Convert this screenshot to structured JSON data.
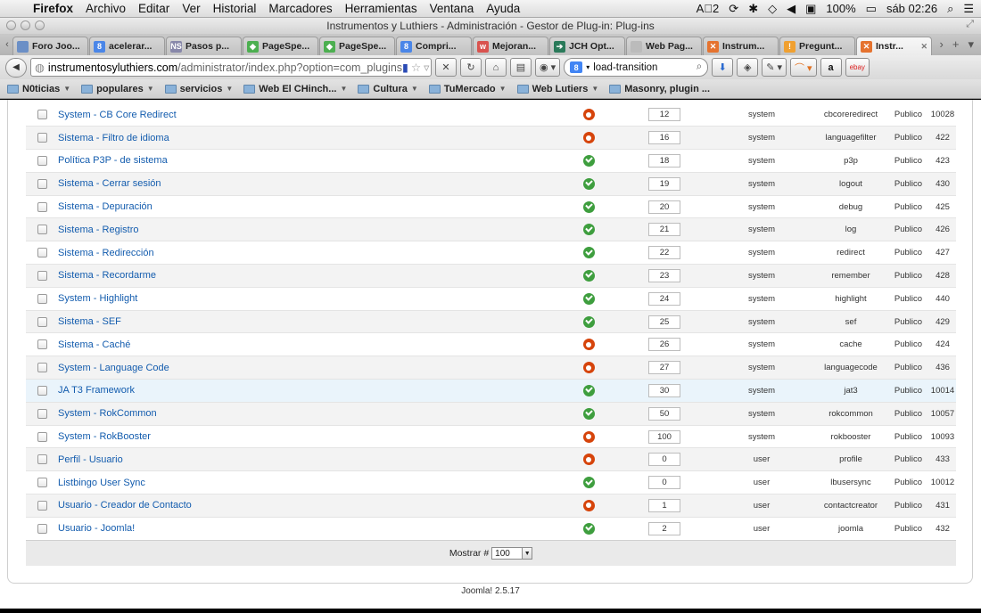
{
  "menubar": {
    "app": "Firefox",
    "items": [
      "Archivo",
      "Editar",
      "Ver",
      "Historial",
      "Marcadores",
      "Herramientas",
      "Ventana",
      "Ayuda"
    ],
    "status": {
      "ai": "A⃞2",
      "battery": "100%",
      "clock": "sáb 02:26"
    }
  },
  "window": {
    "title": "Instrumentos y Luthiers - Administración - Gestor de Plug-in: Plug-ins"
  },
  "tabs": [
    {
      "label": "Foro Joo...",
      "color": "#6b8fc6",
      "glyph": "",
      "active": false
    },
    {
      "label": "acelerar...",
      "color": "#4a86e8",
      "glyph": "8",
      "active": false
    },
    {
      "label": "Pasos p...",
      "color": "#8888aa",
      "glyph": "NS",
      "active": false
    },
    {
      "label": "PageSpe...",
      "color": "#4caf50",
      "glyph": "◆",
      "active": false
    },
    {
      "label": "PageSpe...",
      "color": "#4caf50",
      "glyph": "◆",
      "active": false
    },
    {
      "label": "Compri...",
      "color": "#4a86e8",
      "glyph": "8",
      "active": false
    },
    {
      "label": "Mejoran...",
      "color": "#d9534f",
      "glyph": "w",
      "active": false
    },
    {
      "label": "JCH Opt...",
      "color": "#2a7a5a",
      "glyph": "➔",
      "active": false
    },
    {
      "label": "Web Pag...",
      "color": "#bbbbbb",
      "glyph": "",
      "active": false
    },
    {
      "label": "Instrum...",
      "color": "#e5732f",
      "glyph": "✕",
      "active": false
    },
    {
      "label": "Pregunt...",
      "color": "#f0a030",
      "glyph": "!",
      "active": false
    },
    {
      "label": "Instr...",
      "color": "#e5732f",
      "glyph": "✕",
      "active": true
    }
  ],
  "nav": {
    "url_host": "instrumentosyluthiers.com",
    "url_path": "/administrator/index.php?option=com_plugins",
    "search_value": "load-transition"
  },
  "bookmarks": [
    {
      "label": "N0ticias",
      "menu": true
    },
    {
      "label": "populares",
      "menu": true
    },
    {
      "label": "servicios",
      "menu": true
    },
    {
      "label": "Web El CHinch...",
      "menu": true
    },
    {
      "label": "Cultura",
      "menu": true
    },
    {
      "label": "TuMercado",
      "menu": true
    },
    {
      "label": "Web Lutiers",
      "menu": true
    },
    {
      "label": "Masonry, plugin ...",
      "menu": false
    }
  ],
  "plugins": [
    {
      "name": "System - CB Core Redirect",
      "enabled": false,
      "order": "12",
      "type": "system",
      "element": "cbcoreredirect",
      "access": "Publico",
      "id": "10028"
    },
    {
      "name": "Sistema - Filtro de idioma",
      "enabled": false,
      "order": "16",
      "type": "system",
      "element": "languagefilter",
      "access": "Publico",
      "id": "422"
    },
    {
      "name": "Política P3P - de sistema",
      "enabled": true,
      "order": "18",
      "type": "system",
      "element": "p3p",
      "access": "Publico",
      "id": "423"
    },
    {
      "name": "Sistema - Cerrar sesión",
      "enabled": true,
      "order": "19",
      "type": "system",
      "element": "logout",
      "access": "Publico",
      "id": "430"
    },
    {
      "name": "Sistema - Depuración",
      "enabled": true,
      "order": "20",
      "type": "system",
      "element": "debug",
      "access": "Publico",
      "id": "425"
    },
    {
      "name": "Sistema - Registro",
      "enabled": true,
      "order": "21",
      "type": "system",
      "element": "log",
      "access": "Publico",
      "id": "426"
    },
    {
      "name": "Sistema - Redirección",
      "enabled": true,
      "order": "22",
      "type": "system",
      "element": "redirect",
      "access": "Publico",
      "id": "427"
    },
    {
      "name": "Sistema - Recordarme",
      "enabled": true,
      "order": "23",
      "type": "system",
      "element": "remember",
      "access": "Publico",
      "id": "428"
    },
    {
      "name": "System - Highlight",
      "enabled": true,
      "order": "24",
      "type": "system",
      "element": "highlight",
      "access": "Publico",
      "id": "440"
    },
    {
      "name": "Sistema - SEF",
      "enabled": true,
      "order": "25",
      "type": "system",
      "element": "sef",
      "access": "Publico",
      "id": "429"
    },
    {
      "name": "Sistema - Caché",
      "enabled": false,
      "order": "26",
      "type": "system",
      "element": "cache",
      "access": "Publico",
      "id": "424"
    },
    {
      "name": "System - Language Code",
      "enabled": false,
      "order": "27",
      "type": "system",
      "element": "languagecode",
      "access": "Publico",
      "id": "436"
    },
    {
      "name": "JA T3 Framework",
      "enabled": true,
      "order": "30",
      "type": "system",
      "element": "jat3",
      "access": "Publico",
      "id": "10014"
    },
    {
      "name": "System - RokCommon",
      "enabled": true,
      "order": "50",
      "type": "system",
      "element": "rokcommon",
      "access": "Publico",
      "id": "10057"
    },
    {
      "name": "System - RokBooster",
      "enabled": false,
      "order": "100",
      "type": "system",
      "element": "rokbooster",
      "access": "Publico",
      "id": "10093"
    },
    {
      "name": "Perfil - Usuario",
      "enabled": false,
      "order": "0",
      "type": "user",
      "element": "profile",
      "access": "Publico",
      "id": "433"
    },
    {
      "name": "Listbingo User Sync",
      "enabled": true,
      "order": "0",
      "type": "user",
      "element": "lbusersync",
      "access": "Publico",
      "id": "10012"
    },
    {
      "name": "Usuario - Creador de Contacto",
      "enabled": false,
      "order": "1",
      "type": "user",
      "element": "contactcreator",
      "access": "Publico",
      "id": "431"
    },
    {
      "name": "Usuario - Joomla!",
      "enabled": true,
      "order": "2",
      "type": "user",
      "element": "joomla",
      "access": "Publico",
      "id": "432"
    }
  ],
  "pager": {
    "label": "Mostrar #",
    "value": "100"
  },
  "footer": {
    "text": "Joomla! 2.5.17"
  }
}
